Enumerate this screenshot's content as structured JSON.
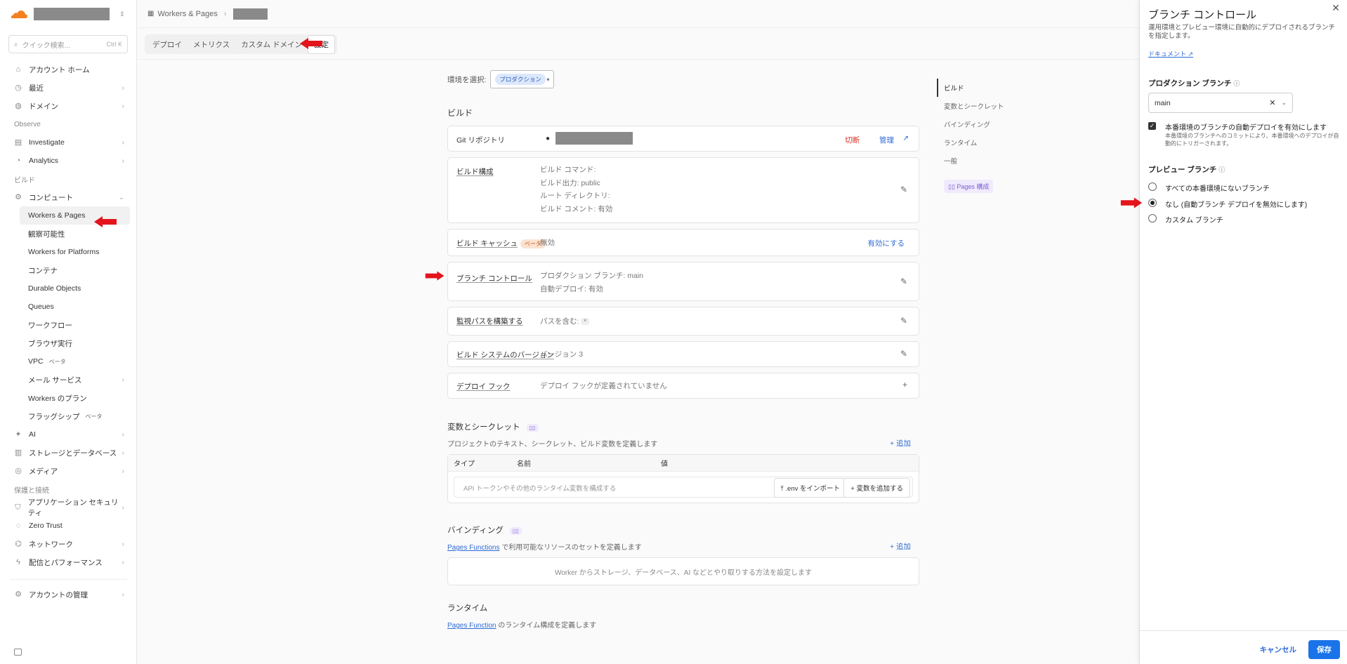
{
  "sidebar": {
    "search_placeholder": "クイック検索...",
    "search_shortcut": "Ctrl K",
    "items": [
      {
        "label": "アカウント ホーム",
        "icon": "home-icon"
      },
      {
        "label": "最近",
        "icon": "clock-icon",
        "chevron": true
      },
      {
        "label": "ドメイン",
        "icon": "globe-icon",
        "chevron": true
      }
    ],
    "section_observe": "Observe",
    "observe_items": [
      {
        "label": "Investigate",
        "icon": "investigate-icon",
        "chevron": true
      },
      {
        "label": "Analytics",
        "icon": "analytics-icon",
        "chevron": true
      }
    ],
    "section_build": "ビルド",
    "compute_label": "コンピュート",
    "compute_sub": [
      {
        "label": "Workers & Pages"
      },
      {
        "label": "観察可能性"
      },
      {
        "label": "Workers for Platforms"
      },
      {
        "label": "コンテナ"
      },
      {
        "label": "Durable Objects"
      },
      {
        "label": "Queues"
      },
      {
        "label": "ワークフロー"
      },
      {
        "label": "ブラウザ実行"
      },
      {
        "label": "VPC",
        "badge": "ベータ"
      },
      {
        "label": "メール サービス",
        "chevron": true
      },
      {
        "label": "Workers のプラン"
      },
      {
        "label": "フラッグシップ",
        "badge": "ベータ"
      }
    ],
    "build_items": [
      {
        "label": "AI",
        "icon": "ai-icon",
        "chevron": true
      },
      {
        "label": "ストレージとデータベース",
        "icon": "database-icon",
        "chevron": true
      },
      {
        "label": "メディア",
        "icon": "media-icon",
        "chevron": true
      }
    ],
    "section_protect": "保護と接続",
    "protect_items": [
      {
        "label": "アプリケーション セキュリティ",
        "icon": "shield-icon",
        "chevron": true
      },
      {
        "label": "Zero Trust",
        "icon": "zero-trust-icon"
      },
      {
        "label": "ネットワーク",
        "icon": "network-icon",
        "chevron": true
      },
      {
        "label": "配信とパフォーマンス",
        "icon": "bolt-icon",
        "chevron": true
      }
    ],
    "manage_label": "アカウントの管理"
  },
  "breadcrumb": {
    "root": "Workers & Pages"
  },
  "tabs": [
    "デプロイ",
    "メトリクス",
    "カスタム ドメイン",
    "設定"
  ],
  "env": {
    "label": "環境を選択:",
    "value": "プロダクション"
  },
  "build": {
    "title": "ビルド",
    "git": {
      "label": "Git リポジトリ",
      "disconnect": "切断",
      "manage": "管理"
    },
    "config": {
      "label": "ビルド構成",
      "lines": [
        "ビルド コマンド:",
        "ビルド出力: public",
        "ルート ディレクトリ:",
        "ビルド コメント: 有効"
      ]
    },
    "cache": {
      "label": "ビルド キャッシュ",
      "badge": "ベータ",
      "value": "無効",
      "action": "有効にする"
    },
    "branch": {
      "label": "ブランチ コントロール",
      "lines": [
        "プロダクション ブランチ: main",
        "自動デプロイ: 有効"
      ]
    },
    "watch": {
      "label": "監視パスを構築する",
      "value": "パスを含む:",
      "chip": "*"
    },
    "version": {
      "label": "ビルド システムのバージョン",
      "value": "バージョン 3"
    },
    "hook": {
      "label": "デプロイ フック",
      "value": "デプロイ フックが定義されていません"
    }
  },
  "vars": {
    "title": "変数とシークレット",
    "desc": "プロジェクトのテキスト、シークレット、ビルド変数を定義します",
    "add": "追加",
    "cols": [
      "タイプ",
      "名前",
      "値"
    ],
    "empty": "API トークンやその他のランタイム変数を構成する",
    "import": ".env をインポート",
    "add_var": "変数を追加する"
  },
  "bindings": {
    "title": "バインディング",
    "link": "Pages Functions",
    "desc": " で利用可能なリソースのセットを定義します",
    "add": "追加",
    "empty": "Worker からストレージ、データベース、AI などとやり取りする方法を設定します"
  },
  "runtime": {
    "title": "ランタイム",
    "link": "Pages Function",
    "desc": " のランタイム構成を定義します"
  },
  "rightnav": [
    "ビルド",
    "変数とシークレット",
    "バインディング",
    "ランタイム",
    "一般"
  ],
  "rightnav_badge": "Pages 構成",
  "panel": {
    "title": "ブランチ コントロール",
    "desc": "運用環境とプレビュー環境に自動的にデプロイされるブランチを指定します。",
    "doc": "ドキュメント",
    "prod_label": "プロダクション ブランチ",
    "prod_value": "main",
    "auto_label": "本番環境のブランチの自動デプロイを有効にします",
    "auto_desc": "本番環境のブランチへのコミットにより、本番環境へのデプロイが自動的にトリガーされます。",
    "preview_label": "プレビュー ブランチ",
    "options": [
      "すべての本番環境にないブランチ",
      "なし (自動ブランチ デプロイを無効にします)",
      "カスタム ブランチ"
    ],
    "selected_option": 1,
    "cancel": "キャンセル",
    "save": "保存"
  },
  "colors": {
    "accent": "#1a73e8",
    "annotation_arrow": "#e3141b",
    "cloudflare_orange": "#f48120"
  }
}
